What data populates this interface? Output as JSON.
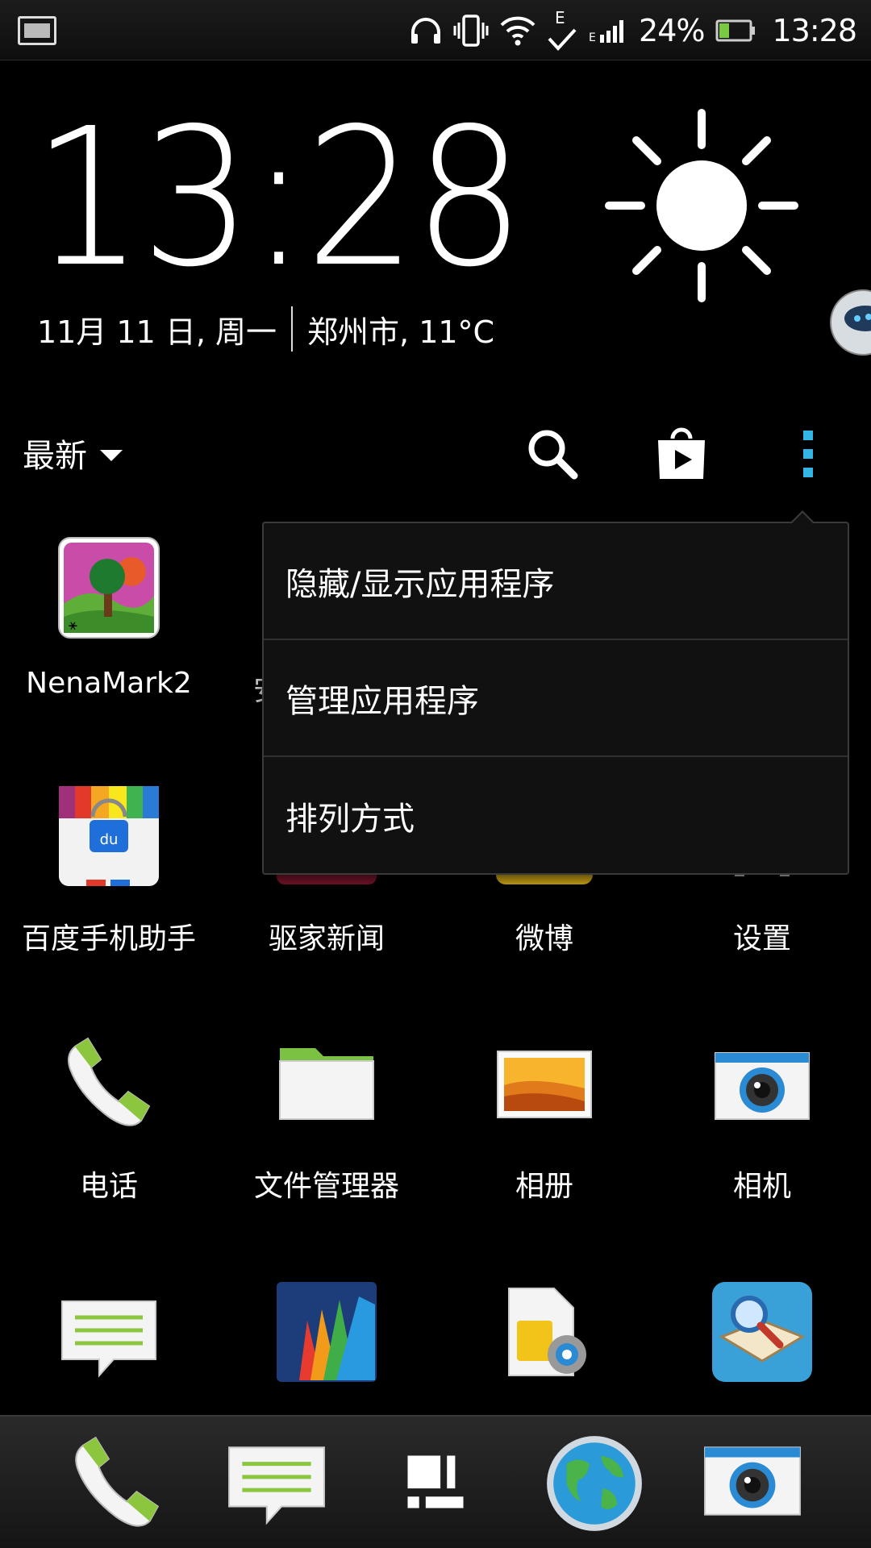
{
  "status_bar": {
    "network_label": "E",
    "battery_percent": "24%",
    "time": "13:28",
    "icons": [
      "notification-icon",
      "headphones-icon",
      "vibrate-icon",
      "wifi-icon",
      "check-icon",
      "signal-icon",
      "battery-icon"
    ]
  },
  "clock_widget": {
    "time": "13:28",
    "date": "11月 11 日, 周一",
    "location_weather": "郑州市, 11°C",
    "weather_icon": "sunny-icon"
  },
  "app_bar": {
    "filter_label": "最新"
  },
  "menu": {
    "items": [
      "隐藏/显示应用程序",
      "管理应用程序",
      "排列方式"
    ]
  },
  "apps": [
    {
      "label": "NenaMark2",
      "icon": "nenamark-icon"
    },
    {
      "label": "安",
      "icon": "hidden-icon"
    },
    {
      "label": "百度手机助手",
      "icon": "baidu-assistant-icon"
    },
    {
      "label": "驱家新闻",
      "icon": "news-icon"
    },
    {
      "label": "微博",
      "icon": "weibo-icon"
    },
    {
      "label": "设置",
      "icon": "settings-icon"
    },
    {
      "label": "电话",
      "icon": "phone-icon"
    },
    {
      "label": "文件管理器",
      "icon": "folder-icon"
    },
    {
      "label": "相册",
      "icon": "gallery-icon"
    },
    {
      "label": "相机",
      "icon": "camera-icon"
    },
    {
      "label": "",
      "icon": "messages-icon"
    },
    {
      "label": "",
      "icon": "polaris-icon"
    },
    {
      "label": "",
      "icon": "sim-toolkit-icon"
    },
    {
      "label": "",
      "icon": "dictionary-icon"
    }
  ],
  "dock": [
    "phone-icon",
    "messages-icon",
    "blinkfeed-icon",
    "browser-icon",
    "camera-icon"
  ],
  "colors": {
    "accent_blue": "#33b5e5",
    "phone_green": "#8cc63f",
    "battery_green": "#7ac943"
  }
}
